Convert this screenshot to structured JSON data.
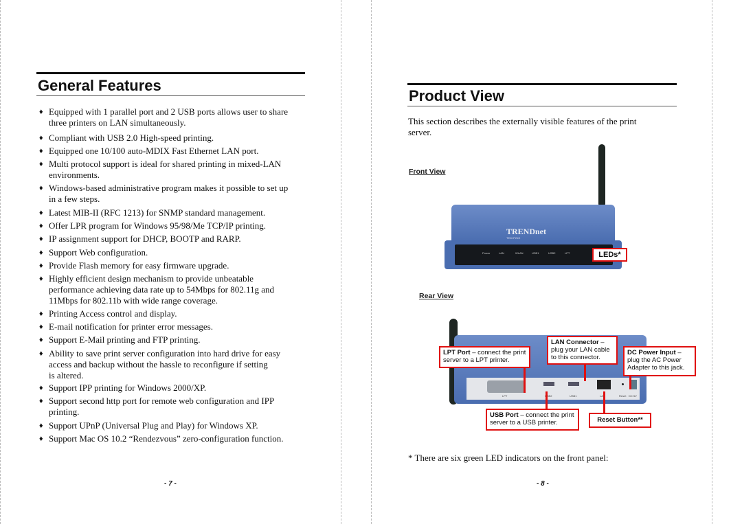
{
  "left_page": {
    "title": "General Features",
    "items": [
      [
        "Equipped with 1 parallel port and 2 USB ports allows user to share",
        "three printers on LAN simultaneously."
      ],
      [
        "Compliant with USB 2.0 High-speed printing."
      ],
      [
        "Equipped one 10/100 auto-MDIX Fast Ethernet LAN port."
      ],
      [
        "Multi protocol support is ideal for shared printing in mixed-LAN",
        "environments."
      ],
      [
        "Windows-based administrative program makes it possible to set up",
        "in a few steps."
      ],
      [
        "Latest MIB-II (RFC 1213) for SNMP standard management."
      ],
      [
        "Offer LPR program for Windows 95/98/Me TCP/IP printing."
      ],
      [
        "IP assignment support for DHCP, BOOTP and RARP."
      ],
      [
        "Support Web configuration."
      ],
      [
        "Provide Flash memory for easy firmware upgrade."
      ],
      [
        "Highly efficient design mechanism to provide unbeatable",
        "performance achieving data rate up to 54Mbps for 802.11g and",
        "11Mbps for 802.11b with wide range coverage."
      ],
      [
        "Printing Access control and display."
      ],
      [
        "E-mail notification for printer error messages."
      ],
      [
        "Support E-Mail printing and FTP printing."
      ],
      [
        "Ability to save print server configuration into hard drive for easy",
        "access and backup without the hassle to reconfigure if setting",
        "is altered."
      ],
      [
        "Support IPP printing for Windows 2000/XP."
      ],
      [
        "Support second http port for remote web configuration and IPP",
        "printing."
      ],
      [
        "Support UPnP (Universal Plug and Play) for Windows XP."
      ],
      [
        "Support Mac OS 10.2 “Rendezvous” zero-configuration function."
      ]
    ],
    "page_number": "- 7 -"
  },
  "right_page": {
    "title": "Product View",
    "intro_line1": "This  section  describes  the  externally  visible  features  of  the  print",
    "intro_line2": "server.",
    "front_view_label": "Front View",
    "rear_view_label": "Rear View",
    "brand": "TRENDnet",
    "model": "TEW-P21G",
    "led_labels": [
      "Power",
      "LAN",
      "WLAN",
      "USB1",
      "USB2",
      "LPT"
    ],
    "callouts": {
      "leds": "LEDs*",
      "lpt_title": "LPT Port",
      "lpt_text": " –  connect the print server to a LPT printer.",
      "lan_title": "LAN Connector",
      "lan_text": " – plug your LAN cable to this connector.",
      "dc_title": "DC Power Input",
      "dc_text": " – plug the AC Power Adapter to this jack.",
      "usb_title": "USB Port",
      "usb_text": " – connect the print server to a USB printer.",
      "reset": "Reset Button**"
    },
    "port_labels": [
      "LPT",
      "USB2",
      "USB1",
      "LAN",
      "Reset",
      "DC 5V"
    ],
    "footnote": "* There are six green LED indicators on the front panel:",
    "page_number": "- 8 -"
  },
  "colors": {
    "device_blue": "#4a6db0",
    "callout_red": "#e01010"
  }
}
